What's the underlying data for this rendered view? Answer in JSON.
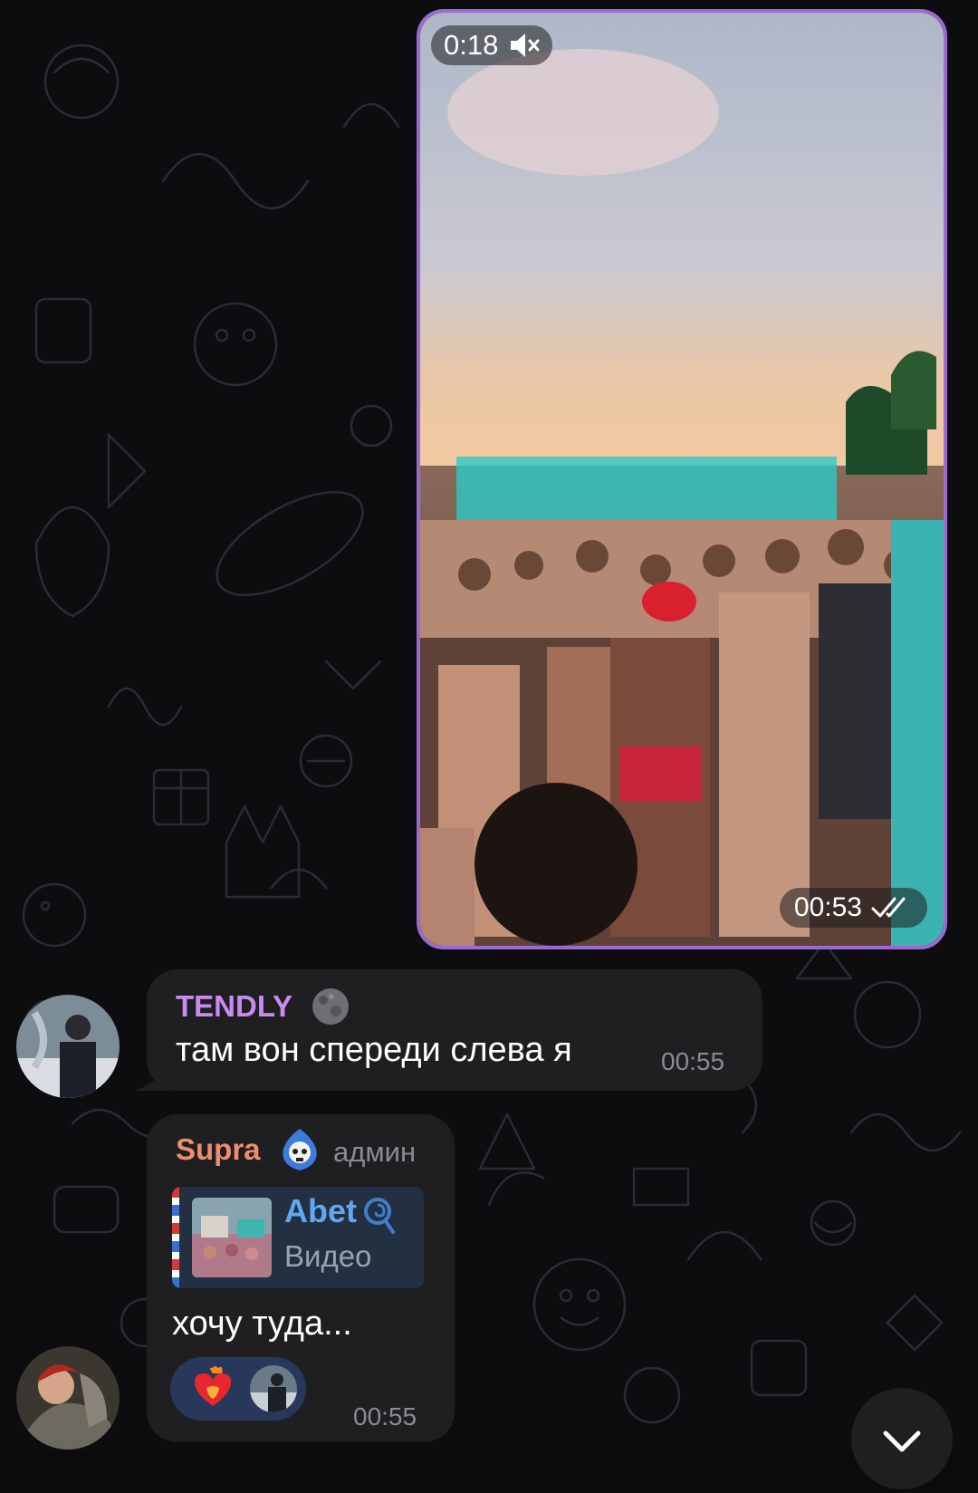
{
  "video_message": {
    "duration_label": "0:18",
    "muted_icon": "speaker-muted-icon",
    "time": "00:53",
    "read_icon": "double-check-icon"
  },
  "messages": [
    {
      "sender": "TENDLY",
      "sender_color": "#c88cf0",
      "text": "там вон спереди слева я",
      "time": "00:55"
    },
    {
      "sender": "Supra",
      "sender_color": "#ef8c6e",
      "role": "админ",
      "reply": {
        "name": "Abet",
        "subtitle": "Видео"
      },
      "text": "хочу туда...",
      "reactions": [
        "heart-on-fire-emoji",
        "user-avatar"
      ],
      "time": "00:55"
    }
  ],
  "colors": {
    "video_border": "#9a6ad0",
    "bubble_bg": "#1f1f22",
    "reply_name": "#5fa8ef",
    "reaction_bg": "#27385a"
  }
}
